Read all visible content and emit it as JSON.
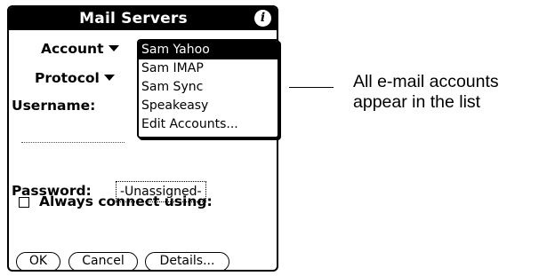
{
  "title": "Mail Servers",
  "info_icon": "info-icon",
  "account": {
    "label": "Account"
  },
  "protocol": {
    "label": "Protocol"
  },
  "username": {
    "label": "Username:"
  },
  "password": {
    "label": "Password:",
    "value": "-Unassigned-"
  },
  "always_connect": {
    "label": "Always connect using:",
    "checked": false
  },
  "buttons": {
    "ok": "OK",
    "cancel": "Cancel",
    "details": "Details..."
  },
  "account_list": {
    "items": [
      "Sam Yahoo",
      "Sam IMAP",
      "Sam Sync",
      "Speakeasy",
      "Edit Accounts..."
    ],
    "selected": "Sam Yahoo"
  },
  "callout": {
    "line1": "All e-mail accounts",
    "line2": "appear in the list"
  }
}
